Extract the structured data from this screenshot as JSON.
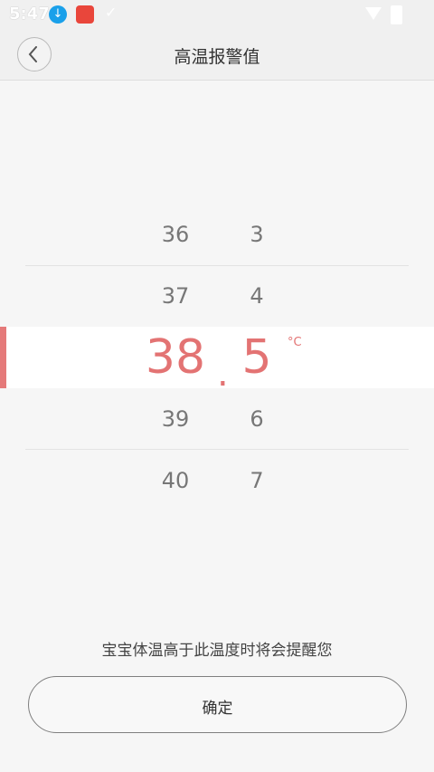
{
  "status_bar": {
    "time": "5:47",
    "icons": [
      "download-icon",
      "app-notification-icon",
      "check-icon",
      "wifi-icon",
      "battery-icon"
    ]
  },
  "header": {
    "title": "高温报警值",
    "back_icon": "chevron-left-icon"
  },
  "picker": {
    "integer_values": [
      "36",
      "37",
      "38",
      "39",
      "40"
    ],
    "decimal_values": [
      "3",
      "4",
      "5",
      "6",
      "7"
    ],
    "selected_integer": "38",
    "selected_decimal": "5",
    "separator": ".",
    "unit": "°C",
    "accent_color": "#e37373"
  },
  "footer": {
    "hint": "宝宝体温高于此温度时将会提醒您",
    "confirm_label": "确定"
  }
}
